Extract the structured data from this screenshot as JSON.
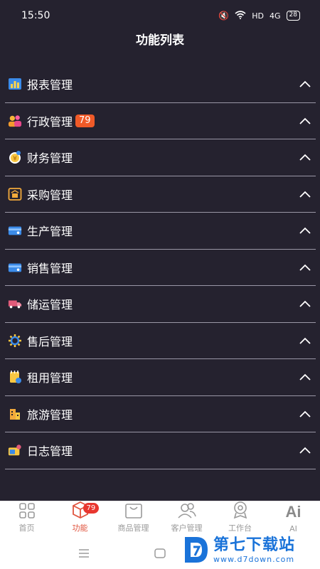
{
  "status_bar": {
    "time": "15:50",
    "network": "HD",
    "signal": "4G",
    "battery": "28"
  },
  "header": {
    "title": "功能列表"
  },
  "menu": [
    {
      "label": "报表管理",
      "icon": "report-chart-icon",
      "badge": ""
    },
    {
      "label": "行政管理",
      "icon": "admin-people-icon",
      "badge": "79"
    },
    {
      "label": "财务管理",
      "icon": "finance-coin-icon",
      "badge": ""
    },
    {
      "label": "采购管理",
      "icon": "purchase-basket-icon",
      "badge": ""
    },
    {
      "label": "生产管理",
      "icon": "production-card-icon",
      "badge": ""
    },
    {
      "label": "销售管理",
      "icon": "sales-card-icon",
      "badge": ""
    },
    {
      "label": "储运管理",
      "icon": "delivery-truck-icon",
      "badge": ""
    },
    {
      "label": "售后管理",
      "icon": "after-sales-gear-icon",
      "badge": ""
    },
    {
      "label": "租用管理",
      "icon": "rental-note-icon",
      "badge": ""
    },
    {
      "label": "旅游管理",
      "icon": "travel-building-icon",
      "badge": ""
    },
    {
      "label": "日志管理",
      "icon": "log-person-icon",
      "badge": ""
    }
  ],
  "tabs": [
    {
      "label": "首页",
      "icon": "home-grid-icon",
      "badge": "",
      "active": false
    },
    {
      "label": "功能",
      "icon": "function-cube-icon",
      "badge": "79",
      "active": true
    },
    {
      "label": "商品管理",
      "icon": "goods-bag-icon",
      "badge": "",
      "active": false
    },
    {
      "label": "客户管理",
      "icon": "customers-icon",
      "badge": "",
      "active": false
    },
    {
      "label": "工作台",
      "icon": "workbench-icon",
      "badge": "",
      "active": false
    },
    {
      "label": "AI",
      "icon": "ai-text-icon",
      "badge": "",
      "active": false
    }
  ],
  "tab_ai_text": "Ai",
  "watermark": {
    "title": "第七下载站",
    "url": "www.d7down.com"
  },
  "colors": {
    "background": "#25222f",
    "badge": "#f05a28",
    "active_tab": "#e0543e",
    "watermark": "#1a73d9"
  }
}
